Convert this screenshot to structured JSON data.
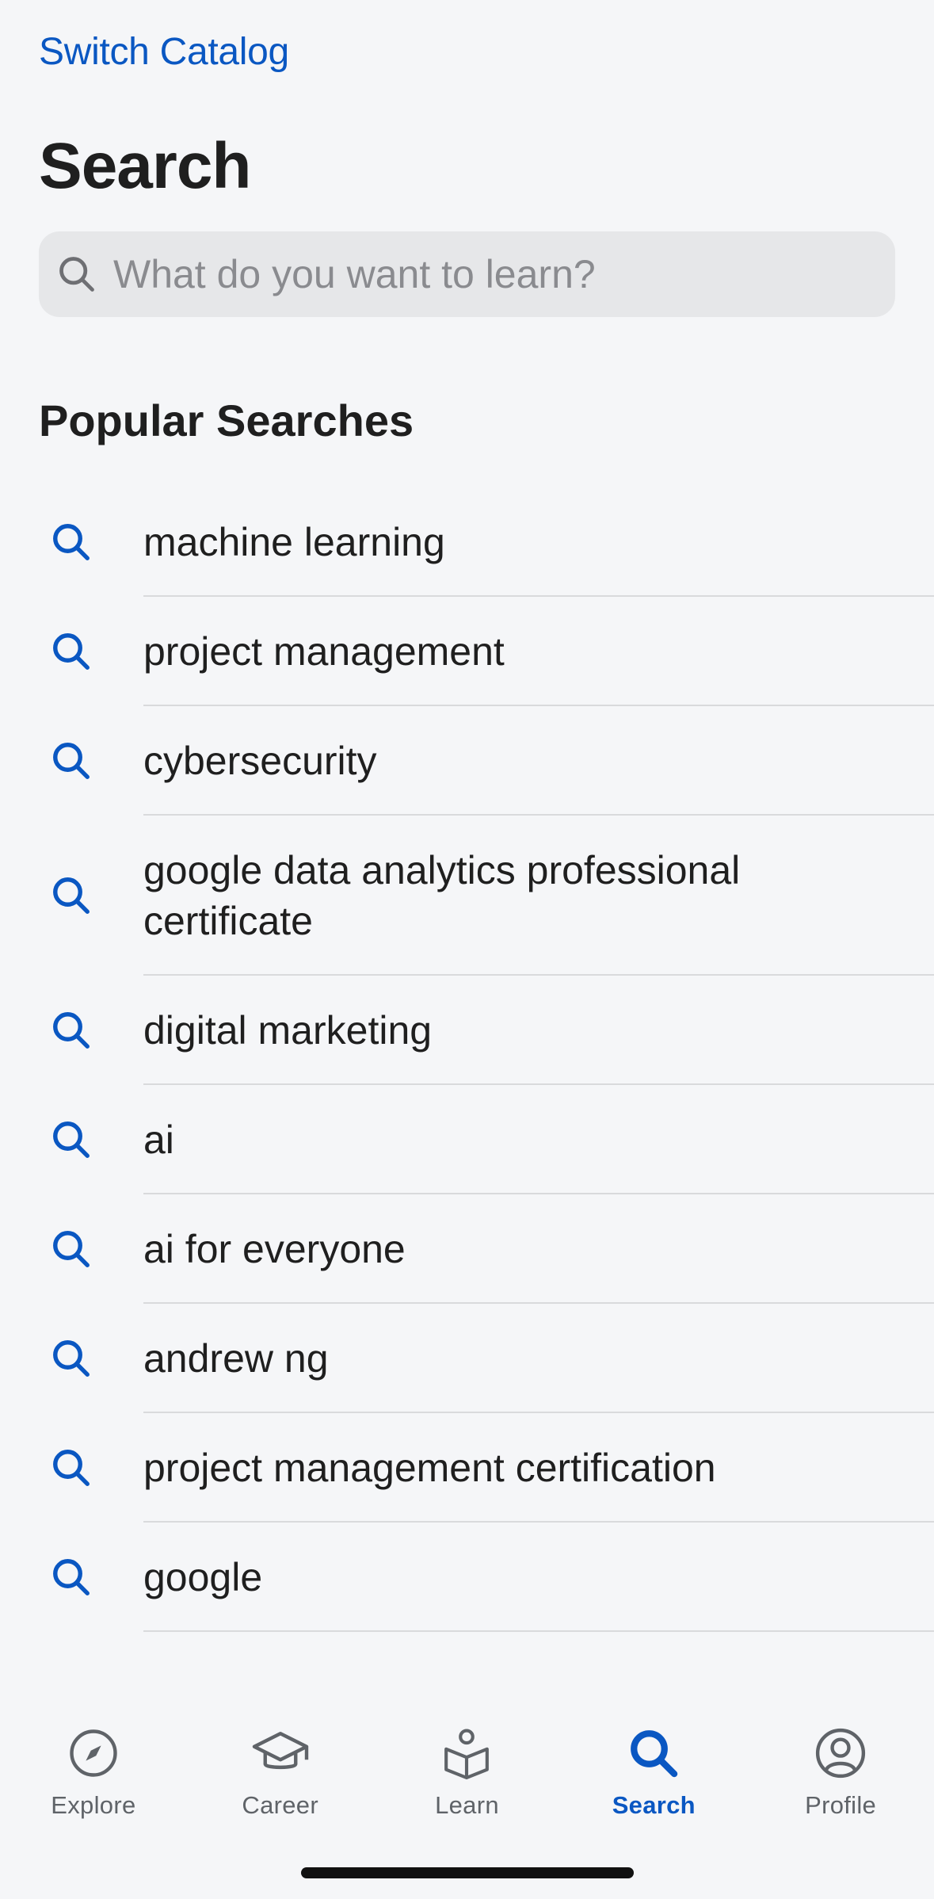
{
  "header": {
    "switch_catalog": "Switch Catalog",
    "title": "Search"
  },
  "search": {
    "placeholder": "What do you want to learn?",
    "icon": "search-icon"
  },
  "popular": {
    "title": "Popular Searches",
    "items": [
      "machine learning",
      "project management",
      "cybersecurity",
      "google data analytics professional certificate",
      "digital marketing",
      "ai",
      "ai for everyone",
      "andrew ng",
      "project management certification",
      "google"
    ]
  },
  "tabbar": {
    "tabs": [
      {
        "label": "Explore",
        "icon": "compass-icon"
      },
      {
        "label": "Career",
        "icon": "graduation-cap-icon"
      },
      {
        "label": "Learn",
        "icon": "learner-book-icon"
      },
      {
        "label": "Search",
        "icon": "search-icon"
      },
      {
        "label": "Profile",
        "icon": "profile-icon"
      }
    ],
    "active": "Search"
  },
  "colors": {
    "accent": "#0a57c2",
    "background": "#f5f6f8",
    "search_field": "#e6e7e9",
    "divider": "#d9dadc",
    "inactive_tab": "#5f6368"
  }
}
